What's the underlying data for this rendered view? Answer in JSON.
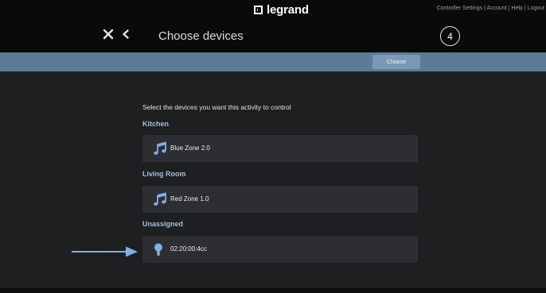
{
  "header": {
    "brand": "legrand",
    "links": "Controller Settings | Account | Help | Logout",
    "title": "Choose devices",
    "step": "4"
  },
  "toolbar": {
    "choose_label": "Choose"
  },
  "main": {
    "instruction": "Select the devices you want this activity to control",
    "groups": [
      {
        "label": "Kitchen",
        "devices": [
          {
            "name": "Blue Zone 2.0",
            "icon": "music-note-icon"
          }
        ]
      },
      {
        "label": "Living Room",
        "devices": [
          {
            "name": "Red Zone 1.0",
            "icon": "music-note-icon"
          }
        ]
      },
      {
        "label": "Unassigned",
        "devices": [
          {
            "name": "02:20:00:4cc",
            "icon": "lightbulb-icon"
          }
        ]
      }
    ]
  },
  "colors": {
    "background": "#1e1f21",
    "topbar": "#0a0a0b",
    "actionbar": "#5e7a97",
    "accent": "#7fb0e6",
    "group_label": "#a9bdd4"
  }
}
